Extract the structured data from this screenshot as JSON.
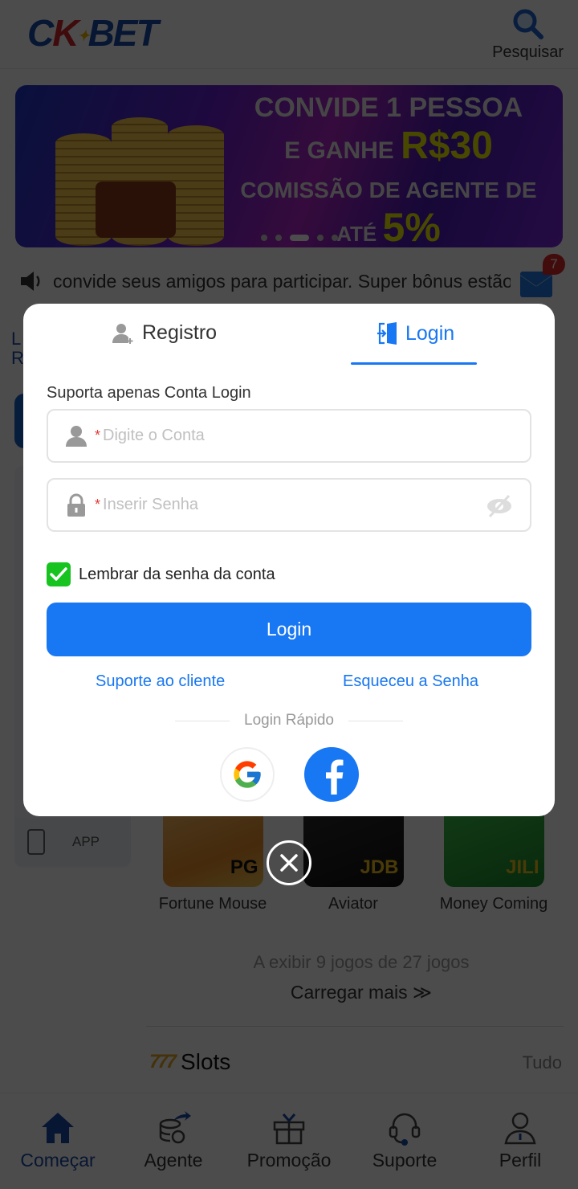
{
  "header": {
    "logo": {
      "c": "C",
      "k": "K",
      "bet": "BET"
    },
    "search_label": "Pesquisar"
  },
  "banner": {
    "line1": "CONVIDE 1 PESSOA",
    "line2_prefix": "E GANHE",
    "line2_amount": "R$30",
    "line3": "COMISSÃO DE AGENTE DE",
    "line4_prefix": "ATÉ",
    "line4_value": "5%",
    "slide_count": 5,
    "active_slide": 3
  },
  "marquee": {
    "text": "convide seus amigos para participar. Super bônus estão",
    "mail_badge": "7"
  },
  "sidebar": {
    "label_line1": "L",
    "label_line2": "R",
    "app_label": "APP"
  },
  "games": [
    {
      "name": "Fortune Mouse",
      "provider": "PG"
    },
    {
      "name": "Aviator",
      "provider": "JDB"
    },
    {
      "name": "Money Coming",
      "provider": "JILI"
    }
  ],
  "games_footer": {
    "showing": "A exibir 9 jogos de 27 jogos",
    "load_more": "Carregar mais"
  },
  "slots_section": {
    "title": "Slots",
    "icon_text": "777",
    "all_label": "Tudo"
  },
  "tabbar": [
    {
      "label": "Começar",
      "icon": "home-icon",
      "active": true
    },
    {
      "label": "Agente",
      "icon": "agent-icon",
      "active": false
    },
    {
      "label": "Promoção",
      "icon": "gift-icon",
      "active": false
    },
    {
      "label": "Suporte",
      "icon": "headset-icon",
      "active": false
    },
    {
      "label": "Perfil",
      "icon": "profile-icon",
      "active": false
    }
  ],
  "modal": {
    "tabs": {
      "register": "Registro",
      "login": "Login",
      "active": "login"
    },
    "support_text": "Suporta apenas Conta Login",
    "account_field": {
      "placeholder": "Digite o Conta",
      "value": "",
      "required_mark": "*"
    },
    "password_field": {
      "placeholder": "Inserir Senha",
      "value": "",
      "required_mark": "*"
    },
    "remember": {
      "label": "Lembrar da senha da conta",
      "checked": true
    },
    "login_button": "Login",
    "links": {
      "support": "Suporte ao cliente",
      "forgot": "Esqueceu a Senha"
    },
    "quick_login_label": "Login Rápido",
    "social": [
      "google",
      "facebook"
    ]
  },
  "colors": {
    "accent": "#1877f2",
    "brand_blue": "#1a4aa8",
    "checkbox_green": "#16c31f",
    "required_red": "#e53935",
    "badge_red": "#e02a2a",
    "banner_highlight": "#f6f200"
  }
}
